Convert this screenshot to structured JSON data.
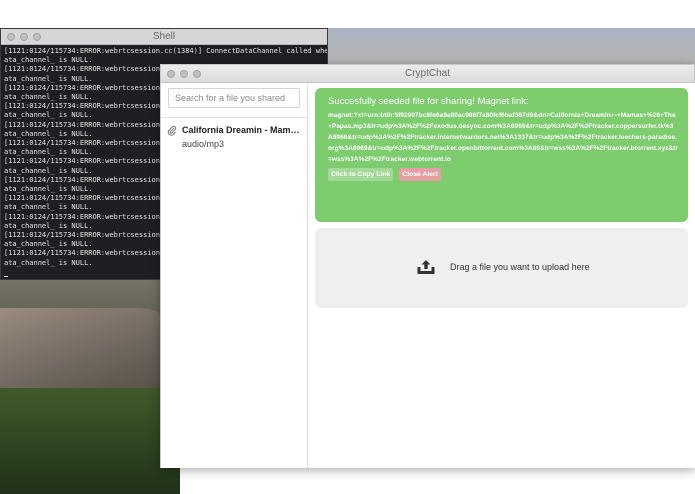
{
  "shell": {
    "title": "Shell",
    "lines": [
      "[1121:0124/115734:ERROR:webrtcsession.cc(1384)] ConnectDataChannel called when d",
      "ata_channel_ is NULL.",
      "[1121:0124/115734:ERROR:webrtcsession.c",
      "ata_channel_ is NULL.",
      "[1121:0124/115734:ERROR:webrtcsession.c",
      "ata_channel_ is NULL.",
      "[1121:0124/115734:ERROR:webrtcsession.c",
      "ata_channel_ is NULL.",
      "[1121:0124/115734:ERROR:webrtcsession.c",
      "ata_channel_ is NULL.",
      "[1121:0124/115734:ERROR:webrtcsession.c",
      "ata_channel_ is NULL.",
      "[1121:0124/115734:ERROR:webrtcsession.c",
      "ata_channel_ is NULL.",
      "[1121:0124/115734:ERROR:webrtcsession.c",
      "ata_channel_ is NULL.",
      "[1121:0124/115734:ERROR:webrtcsession.c",
      "ata_channel_ is NULL.",
      "[1121:0124/115734:ERROR:webrtcsession.c",
      "ata_channel_ is NULL.",
      "[1121:0124/115734:ERROR:webrtcsession.c",
      "ata_channel_ is NULL.",
      "[1121:0124/115734:ERROR:webrtcsession.c",
      "ata_channel_ is NULL."
    ]
  },
  "cryptchat": {
    "title": "CryptChat",
    "search": {
      "placeholder": "Search for a file you shared"
    },
    "files": [
      {
        "name": "California Dreamin - Mamas & Papas.mp3",
        "type": "audio/mp3",
        "icon": "paperclip-icon"
      }
    ],
    "alert": {
      "title": "Succesfully seeded file for sharing! Magnet link:",
      "link": "magnet:?xt=urn:btih:5f92907bc8fe6a9a90ac986f7a80fcf6baf367d9&dn=California+Dreamin+-+Mamas+%26+The+Papas.mp3&tr=udp%3A%2F%2Fexodus.desync.com%3A6969&tr=udp%3A%2F%2Ftracker.coppersurfer.tk%3A6969&tr=udp%3A%2F%2Ftracker.internetwarriors.net%3A1337&tr=udp%3A%2F%2Ftracker.leechers-paradise.org%3A6969&tr=udp%3A%2F%2Ftracker.openbittorrent.com%3A80&tr=wss%3A%2F%2Ftracker.btorrent.xyz&tr=wss%3A%2F%2Ftracker.webtorrent.io",
      "copy_label": "Click to Copy Link",
      "close_label": "Close Alert"
    },
    "dropzone": {
      "label": "Drag a file you want to upload here",
      "icon": "upload-icon"
    }
  },
  "colors": {
    "alert_bg": "#7dcc6e",
    "copy_btn": "#a5d99a",
    "close_btn": "#e6a0a4",
    "dropzone_bg": "#efefef"
  }
}
